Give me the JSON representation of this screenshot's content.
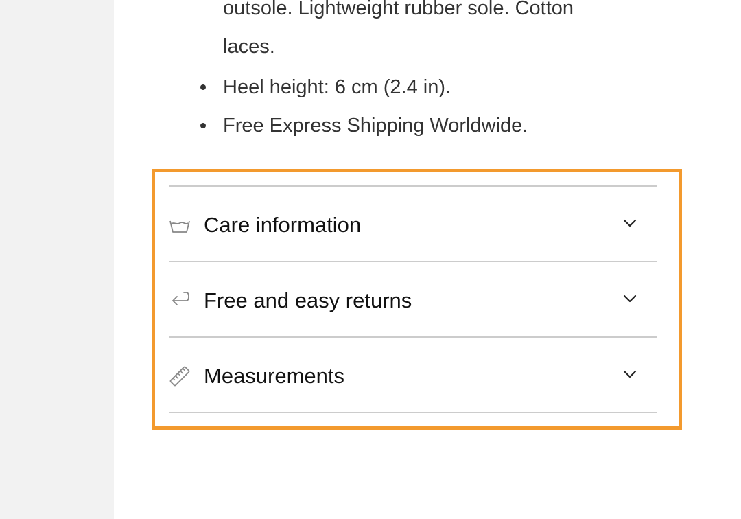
{
  "description": {
    "lines": [
      "outsole. Lightweight rubber sole. Cotton",
      "laces."
    ],
    "bullets": [
      "Heel height: 6 cm (2.4 in).",
      "Free Express Shipping Worldwide."
    ]
  },
  "accordion": {
    "items": [
      {
        "label": "Care information",
        "icon": "wash-basin-icon"
      },
      {
        "label": "Free and easy returns",
        "icon": "return-arrow-icon"
      },
      {
        "label": "Measurements",
        "icon": "ruler-icon"
      }
    ],
    "chevron_icon": "chevron-down-icon"
  },
  "colors": {
    "highlight_border": "#f39a2e",
    "divider": "#cccccc",
    "sidebar_background": "#f2f2f2",
    "icon_color": "#888888"
  }
}
